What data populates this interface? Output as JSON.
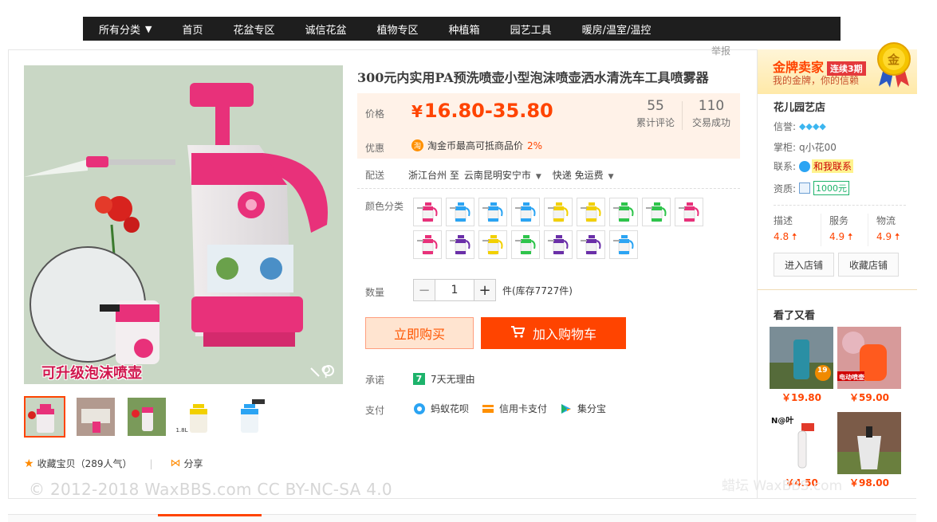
{
  "nav": {
    "items": [
      "所有分类",
      "首页",
      "花盆专区",
      "诚信花盆",
      "植物专区",
      "种植箱",
      "园艺工具",
      "暖房/温室/温控"
    ]
  },
  "report": "举报",
  "product": {
    "title": "300元内实用PA预洗喷壶小型泡沫喷壶洒水清洗车工具喷雾器",
    "main_image_caption": "可升级泡沫喷壶",
    "thumb_label": "1.8L",
    "price_label": "价格",
    "price_symbol": "¥",
    "price": "16.80-35.80",
    "reviews": {
      "num": "55",
      "cap": "累计评论"
    },
    "deals": {
      "num": "110",
      "cap": "交易成功"
    },
    "promo_label": "优惠",
    "coin_glyph": "淘",
    "promo_text": "淘金币最高可抵商品价",
    "promo_pct": "2%",
    "ship_label": "配送",
    "ship_from": "浙江台州 至",
    "ship_to": "云南昆明安宁市",
    "ship_method": "快递 免运费",
    "color_label": "颜色分类",
    "qty_label": "数量",
    "qty_value": "1",
    "qty_minus": "−",
    "qty_plus": "+",
    "stock": "件(库存7727件)",
    "buy_now": "立即购买",
    "add_cart": "加入购物车",
    "promise_label": "承诺",
    "promise_glyph": "7",
    "promise_text": "7天无理由",
    "pay_label": "支付",
    "pay_methods": [
      "蚂蚁花呗",
      "信用卡支付",
      "集分宝"
    ],
    "favorite": "收藏宝贝（289人气）",
    "sep": "|",
    "share": "分享"
  },
  "watermark": "© 2012-2018 WaxBBS.com CC BY-NC-SA 4.0",
  "watermark2": "蜡坛 WaxBBS.com",
  "shop": {
    "gold_title": "金牌卖家",
    "gold_badge": "连续3期",
    "gold_sub": "我的金牌，你的信赖",
    "medal_glyph": "金",
    "name": "花儿园艺店",
    "credit_label": "信誉:",
    "owner_label": "掌柜:",
    "owner": "q小花00",
    "contact_label": "联系:",
    "contact": "和我联系",
    "qual_label": "资质:",
    "qual_value": "1000元",
    "scores": [
      {
        "name": "描述",
        "value": "4.8"
      },
      {
        "name": "服务",
        "value": "4.9"
      },
      {
        "name": "物流",
        "value": "4.9"
      }
    ],
    "enter": "进入店铺",
    "collect": "收藏店铺",
    "seen_title": "看了又看",
    "seen_items": [
      {
        "price": "￥19.80",
        "tag": "19"
      },
      {
        "price": "￥59.00",
        "tag": "电动喷壶"
      },
      {
        "price": "￥4.50",
        "tag": "N@叶"
      },
      {
        "price": "￥98.00",
        "tag": ""
      }
    ]
  },
  "colors": {
    "brand": "#ff4400",
    "nav_bg": "#1e1e1e",
    "pink": "#e8317a"
  }
}
